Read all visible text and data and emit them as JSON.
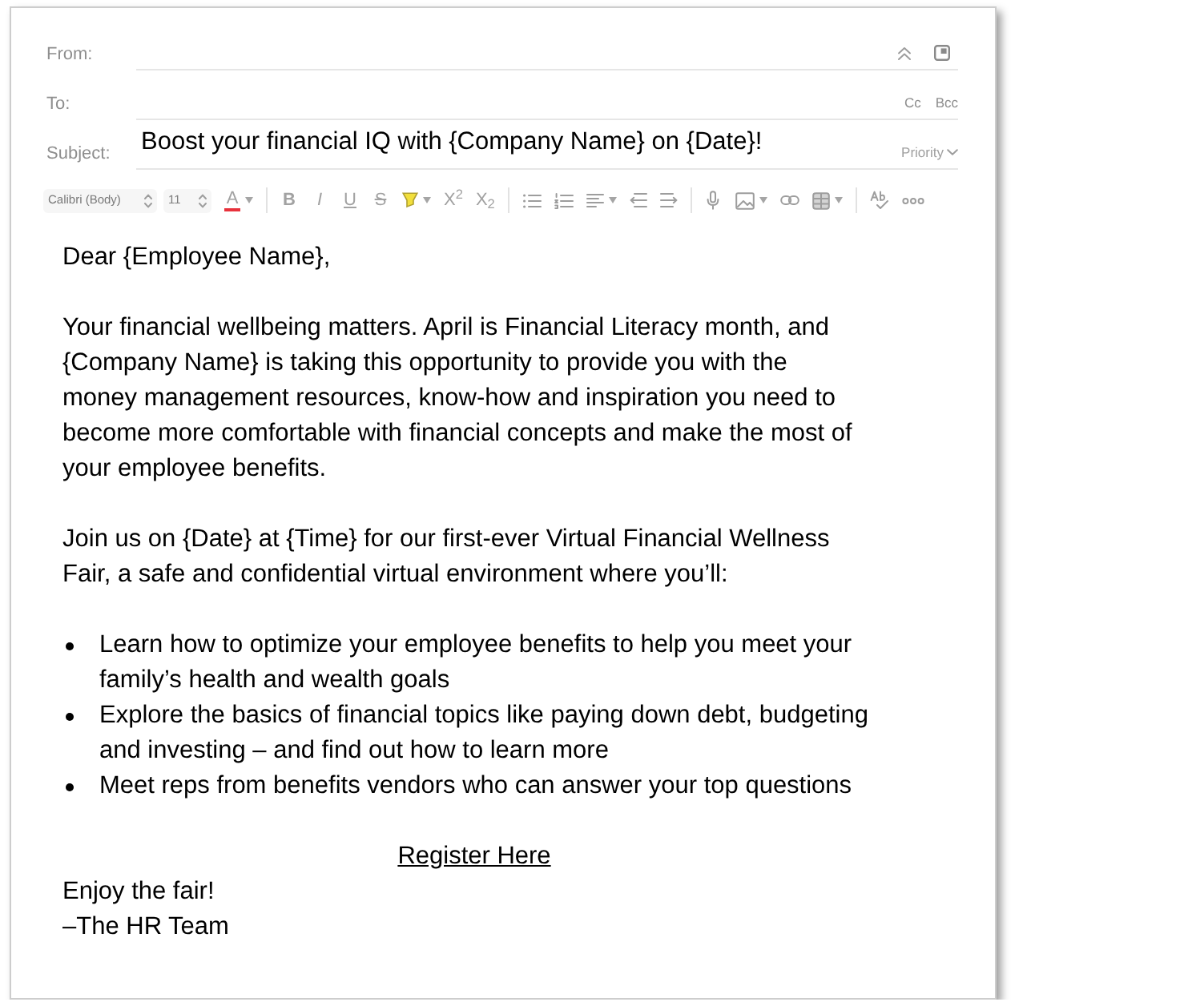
{
  "header": {
    "fields": [
      {
        "kind": "from",
        "label": "From:"
      },
      {
        "kind": "to",
        "label": "To:",
        "actions": [
          "Cc",
          "Bcc"
        ]
      },
      {
        "kind": "subject",
        "label": "Subject:",
        "value": "Boost your financial IQ with {Company Name} on {Date}!",
        "menu": "Priority"
      }
    ]
  },
  "toolbar": {
    "font": "Calibri (Body)",
    "size": "11",
    "groups": [
      [
        {
          "kind": "fontcolor",
          "label": "A",
          "color": "#e8323c",
          "dropdown": true
        }
      ],
      [
        {
          "kind": "bold",
          "label": "B",
          "dropdown": false
        },
        {
          "kind": "italic",
          "label": "I",
          "dropdown": false
        },
        {
          "kind": "underline",
          "label": "U",
          "dropdown": false
        },
        {
          "kind": "strike",
          "label": "S",
          "dropdown": false
        },
        {
          "kind": "highlight",
          "color": "#f2df3c",
          "dropdown": true
        },
        {
          "kind": "superscript",
          "label": "X$^{2}$",
          "dropdown": false
        },
        {
          "kind": "subscript",
          "label": "X$_{2}$",
          "dropdown": false
        }
      ],
      [
        {
          "kind": "bullets",
          "dropdown": false
        },
        {
          "kind": "numbering",
          "dropdown": false
        },
        {
          "kind": "align",
          "dropdown": true
        },
        {
          "kind": "outdent",
          "dropdown": false
        },
        {
          "kind": "indent",
          "dropdown": false
        }
      ],
      [
        {
          "kind": "dictate",
          "dropdown": false
        },
        {
          "kind": "picture",
          "dropdown": true
        },
        {
          "kind": "link",
          "dropdown": false
        },
        {
          "kind": "table",
          "dropdown": true
        }
      ],
      [
        {
          "kind": "spelling",
          "dropdown": false
        },
        {
          "kind": "more",
          "dropdown": false
        }
      ]
    ]
  },
  "body": {
    "greeting": "Dear {Employee Name},",
    "paragraphs": [
      "Your financial wellbeing matters. April is Financial Literacy month, and {Company Name} is taking this opportunity to provide you with the money management resources, know-how and inspiration you need to become more comfortable with financial concepts and make the most of your employee benefits.",
      "Join us on {Date} at {Time} for our first-ever Virtual Financial Wellness Fair, a safe and confidential virtual environment where you’ll:"
    ],
    "bullets": [
      "Learn how to optimize your employee benefits to help you meet your family’s health and wealth goals",
      "Explore the basics of financial topics like paying down debt, budgeting and investing – and find out how to learn more",
      "Meet reps from benefits vendors who can answer your top questions"
    ],
    "link": "Register Here",
    "closing": [
      "Enjoy the fair!",
      "–The HR Team"
    ]
  }
}
